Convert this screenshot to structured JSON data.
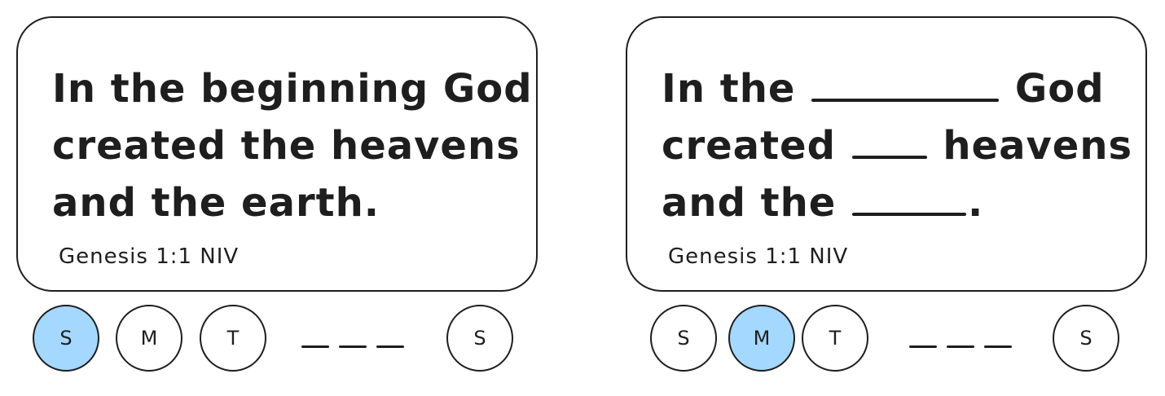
{
  "cards": [
    {
      "id": "full",
      "lines": [
        [
          "In the beginning God"
        ],
        [
          "created the heavens"
        ],
        [
          "and the earth."
        ]
      ],
      "reference": "Genesis 1:1 NIV"
    },
    {
      "id": "cloze",
      "line1_a": "In the",
      "line1_b": "God",
      "line2_a": "created",
      "line2_b": "heavens",
      "line3_a": "and the",
      "line3_b": ".",
      "reference": "Genesis 1:1 NIV"
    }
  ],
  "full_text": {
    "line1": "In the beginning God",
    "line2": "created the heavens",
    "line3": "and the earth."
  },
  "day_selectors": [
    {
      "days": [
        "S",
        "M",
        "T",
        "S"
      ],
      "active_index": 0
    },
    {
      "days": [
        "S",
        "M",
        "T",
        "S"
      ],
      "active_index": 1
    }
  ],
  "colors": {
    "stroke": "#1e1e1e",
    "active_fill": "#a5d8ff",
    "background": "#ffffff"
  }
}
